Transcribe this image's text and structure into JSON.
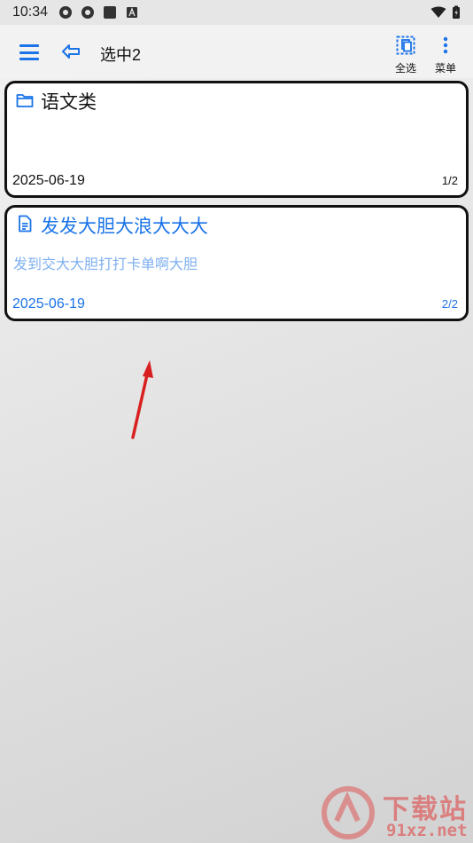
{
  "status_bar": {
    "time": "10:34"
  },
  "app_bar": {
    "title": "选中2",
    "select_all_label": "全选",
    "menu_label": "菜单"
  },
  "cards": [
    {
      "icon": "folder-icon",
      "title": "语文类",
      "body": "",
      "date": "2025-06-19",
      "count": "1/2"
    },
    {
      "icon": "document-icon",
      "title": "发发大胆大浪大大大",
      "body": "发到交大大胆打打卡单啊大胆",
      "date": "2025-06-19",
      "count": "2/2"
    }
  ],
  "watermark": {
    "top": "下载站",
    "bottom": "91xz.net"
  },
  "colors": {
    "accent": "#1a73e8",
    "light_accent": "#7fb0ef",
    "annotation_arrow": "#d92020",
    "watermark": "#e03a3a"
  }
}
